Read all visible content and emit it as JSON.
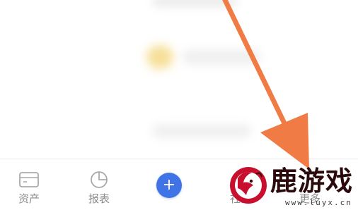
{
  "tabbar": {
    "items": [
      {
        "label": "资产",
        "icon": "wallet-card-icon"
      },
      {
        "label": "报表",
        "icon": "pie-chart-icon"
      },
      {
        "label": "",
        "icon": "plus-icon"
      },
      {
        "label": "社区",
        "icon": "community-icon"
      },
      {
        "label": "更多",
        "icon": "more-icon"
      }
    ],
    "plus_glyph": "+"
  },
  "watermark": {
    "brand": "鹿游戏",
    "url": "www.luyx.cn"
  },
  "colors": {
    "accent": "#3f73e6",
    "arrow": "#f07b45",
    "tab_label": "#8d8d8d",
    "watermark_red": "#c8102e"
  }
}
